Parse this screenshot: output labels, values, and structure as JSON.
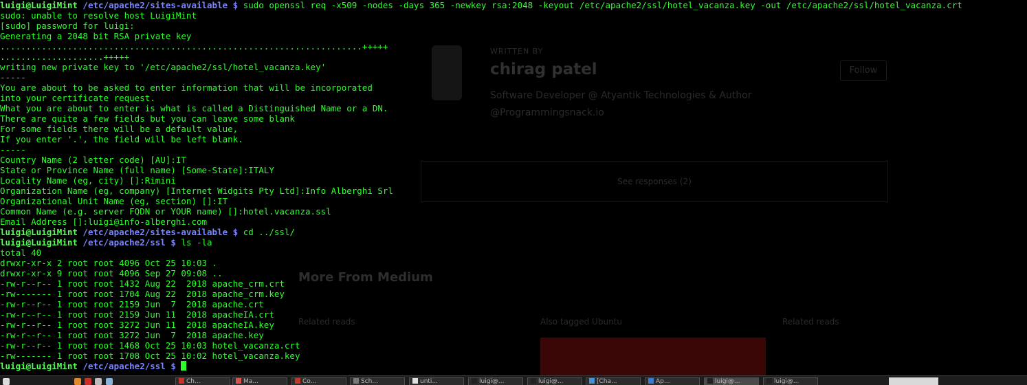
{
  "background_page": {
    "written_by": "WRITTEN BY",
    "author": "chirag patel",
    "follow": "Follow",
    "bio_line1": "Software Developer @ Atyantik Technologies & Author",
    "bio_line2": "@Programmingsnack.io",
    "see_responses": "See responses (2)",
    "more_from": "More From Medium",
    "related_reads_1": "Related reads",
    "also_tagged": "Also tagged Ubuntu",
    "related_reads_2": "Related reads"
  },
  "terminal": {
    "prompt_user": "luigi@LuigiMint",
    "prompt_symbol": "$",
    "lines": [
      {
        "type": "prompt",
        "path": "/etc/apache2/sites-available",
        "cmd": "sudo openssl req -x509 -nodes -days 365 -newkey rsa:2048 -keyout /etc/apache2/ssl/hotel_vacanza.key -out /etc/apache2/ssl/hotel_vacanza.crt"
      },
      {
        "type": "out",
        "text": "sudo: unable to resolve host LuigiMint"
      },
      {
        "type": "out",
        "text": "[sudo] password for luigi:"
      },
      {
        "type": "out",
        "text": "Generating a 2048 bit RSA private key"
      },
      {
        "type": "out",
        "text": "......................................................................+++++"
      },
      {
        "type": "out",
        "text": "....................+++++"
      },
      {
        "type": "out",
        "text": "writing new private key to '/etc/apache2/ssl/hotel_vacanza.key'"
      },
      {
        "type": "out",
        "text": "-----"
      },
      {
        "type": "out",
        "text": "You are about to be asked to enter information that will be incorporated"
      },
      {
        "type": "out",
        "text": "into your certificate request."
      },
      {
        "type": "out",
        "text": "What you are about to enter is what is called a Distinguished Name or a DN."
      },
      {
        "type": "out",
        "text": "There are quite a few fields but you can leave some blank"
      },
      {
        "type": "out",
        "text": "For some fields there will be a default value,"
      },
      {
        "type": "out",
        "text": "If you enter '.', the field will be left blank."
      },
      {
        "type": "out",
        "text": "-----"
      },
      {
        "type": "out",
        "text": "Country Name (2 letter code) [AU]:IT"
      },
      {
        "type": "out",
        "text": "State or Province Name (full name) [Some-State]:ITALY"
      },
      {
        "type": "out",
        "text": "Locality Name (eg, city) []:Rimini"
      },
      {
        "type": "out",
        "text": "Organization Name (eg, company) [Internet Widgits Pty Ltd]:Info Alberghi Srl"
      },
      {
        "type": "out",
        "text": "Organizational Unit Name (eg, section) []:IT"
      },
      {
        "type": "out",
        "text": "Common Name (e.g. server FQDN or YOUR name) []:hotel.vacanza.ssl"
      },
      {
        "type": "out",
        "text": "Email Address []:luigi@info-alberghi.com"
      },
      {
        "type": "prompt",
        "path": "/etc/apache2/sites-available",
        "cmd": "cd ../ssl/"
      },
      {
        "type": "prompt",
        "path": "/etc/apache2/ssl",
        "cmd": "ls -la"
      },
      {
        "type": "out",
        "text": "total 40"
      },
      {
        "type": "out",
        "text": "drwxr-xr-x 2 root root 4096 Oct 25 10:03 ."
      },
      {
        "type": "out",
        "text": "drwxr-xr-x 9 root root 4096 Sep 27 09:08 .."
      },
      {
        "type": "out",
        "text": "-rw-r--r-- 1 root root 1432 Aug 22  2018 apache_crm.crt"
      },
      {
        "type": "out",
        "text": "-rw------- 1 root root 1704 Aug 22  2018 apache_crm.key"
      },
      {
        "type": "out",
        "text": "-rw-r--r-- 1 root root 2159 Jun  7  2018 apache.crt"
      },
      {
        "type": "out",
        "text": "-rw-r--r-- 1 root root 2159 Jun 11  2018 apacheIA.crt"
      },
      {
        "type": "out",
        "text": "-rw-r--r-- 1 root root 3272 Jun 11  2018 apacheIA.key"
      },
      {
        "type": "out",
        "text": "-rw-r--r-- 1 root root 3272 Jun  7  2018 apache.key"
      },
      {
        "type": "out",
        "text": "-rw-r--r-- 1 root root 1468 Oct 25 10:03 hotel_vacanza.crt"
      },
      {
        "type": "out",
        "text": "-rw------- 1 root root 1708 Oct 25 10:02 hotel_vacanza.key"
      },
      {
        "type": "prompt",
        "path": "/etc/apache2/ssl",
        "cmd": "",
        "cursor": true
      }
    ]
  },
  "taskbar": {
    "items": [
      {
        "label": "Ch...",
        "icon_color": "#c9302c"
      },
      {
        "label": "Ma...",
        "icon_color": "#d9534f"
      },
      {
        "label": "Co...",
        "icon_color": "#c0392b"
      },
      {
        "label": "Sch...",
        "icon_color": "#7a7a7a"
      },
      {
        "label": "unti...",
        "icon_color": "#e0e0e0"
      },
      {
        "label": "luigi@...",
        "icon_color": "#222222"
      },
      {
        "label": "luigi@...",
        "icon_color": "#222222"
      },
      {
        "label": "[Cha...",
        "icon_color": "#4a90d9"
      },
      {
        "label": "Ap...",
        "icon_color": "#3a7bd5"
      },
      {
        "label": "luigi@...",
        "icon_color": "#222222",
        "active": true
      },
      {
        "label": "luigi@...",
        "icon_color": "#222222"
      }
    ]
  }
}
